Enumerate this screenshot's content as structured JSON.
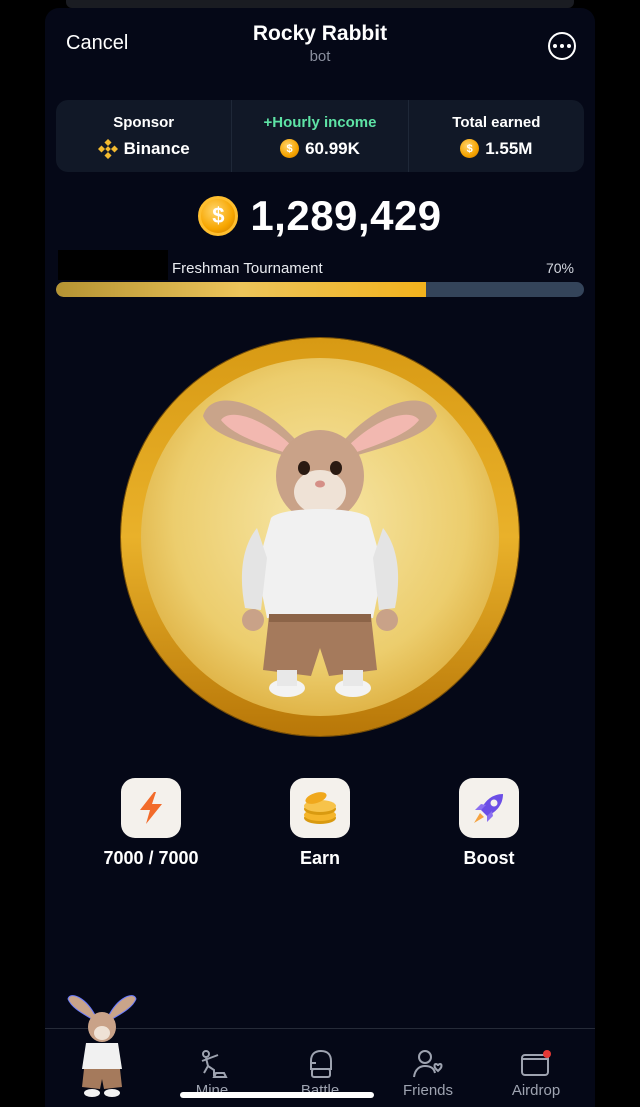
{
  "header": {
    "cancel_label": "Cancel",
    "title": "Rocky Rabbit",
    "subtitle": "bot",
    "more_icon": "ellipsis-circle-icon"
  },
  "stats": {
    "sponsor": {
      "label": "Sponsor",
      "value": "Binance",
      "icon": "binance-icon"
    },
    "hourly_income": {
      "label": "+Hourly income",
      "value": "60.99K",
      "icon": "coin-icon",
      "label_color": "#5ee3a5"
    },
    "total_earned": {
      "label": "Total earned",
      "value": "1.55M",
      "icon": "coin-icon"
    }
  },
  "balance": {
    "value": "1,289,429",
    "icon": "coin-icon"
  },
  "league": {
    "name": "Freshman Tournament",
    "percent_label": "70%",
    "progress": 0.7
  },
  "tap_target": {
    "image": "rabbit-character-coin"
  },
  "actions": [
    {
      "label": "7000 / 7000",
      "icon": "lightning-icon"
    },
    {
      "label": "Earn",
      "icon": "coins-icon"
    },
    {
      "label": "Boost",
      "icon": "rocket-icon"
    }
  ],
  "nav": [
    {
      "label": "",
      "icon": "rabbit-avatar"
    },
    {
      "label": "Mine",
      "icon": "mine-icon"
    },
    {
      "label": "Battle",
      "icon": "glove-icon"
    },
    {
      "label": "Friends",
      "icon": "friends-icon"
    },
    {
      "label": "Airdrop",
      "icon": "wallet-icon"
    }
  ],
  "colors": {
    "background": "#050817",
    "card": "#111827",
    "accent_gold": "#f2b21d",
    "accent_green": "#5ee3a5"
  }
}
